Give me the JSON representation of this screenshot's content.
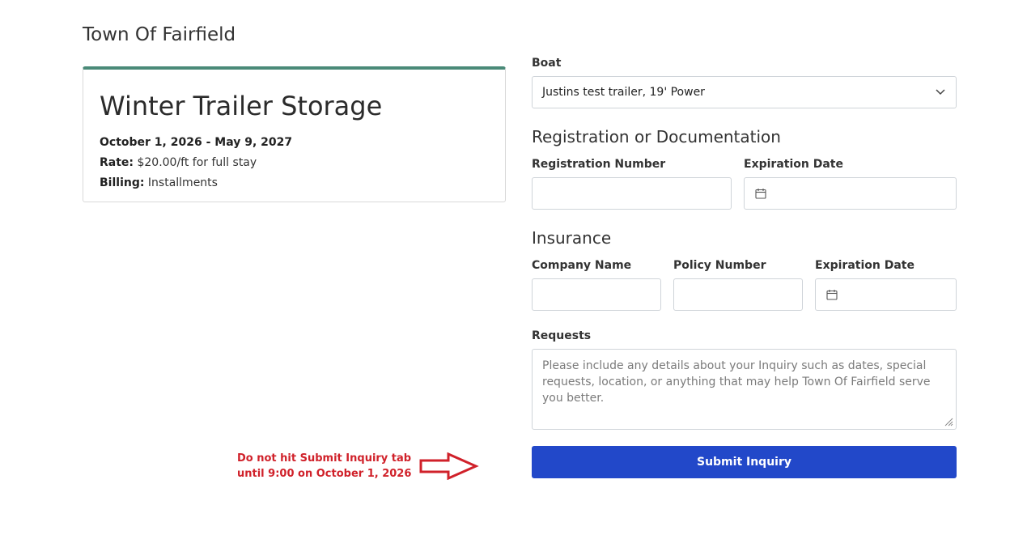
{
  "org": {
    "title": "Town Of Fairfield"
  },
  "card": {
    "title": "Winter Trailer Storage",
    "dates": "October 1, 2026 - May 9, 2027",
    "rate_label": "Rate:",
    "rate_value": "$20.00/ft for full stay",
    "billing_label": "Billing:",
    "billing_value": "Installments",
    "accent_color": "#4a8a78"
  },
  "form": {
    "boat_label": "Boat",
    "boat_selected": "Justins test trailer, 19' Power",
    "registration_section": "Registration or Documentation",
    "registration_number_label": "Registration Number",
    "registration_number_value": "",
    "registration_expiration_label": "Expiration Date",
    "registration_expiration_value": "",
    "insurance_section": "Insurance",
    "company_name_label": "Company Name",
    "company_name_value": "",
    "policy_number_label": "Policy Number",
    "policy_number_value": "",
    "insurance_expiration_label": "Expiration Date",
    "insurance_expiration_value": "",
    "requests_label": "Requests",
    "requests_placeholder": "Please include any details about your Inquiry such as dates, special requests, location, or anything that may help Town Of Fairfield serve you better.",
    "requests_value": "",
    "submit_label": "Submit Inquiry",
    "submit_color": "#2248c9"
  },
  "annotation": {
    "line1": "Do not hit Submit Inquiry tab",
    "line2": "until 9:00 on October 1, 2026",
    "color": "#d0212a"
  },
  "icons": [
    "chevron-down-icon",
    "calendar-icon",
    "resize-handle-icon",
    "arrow-right-icon"
  ]
}
